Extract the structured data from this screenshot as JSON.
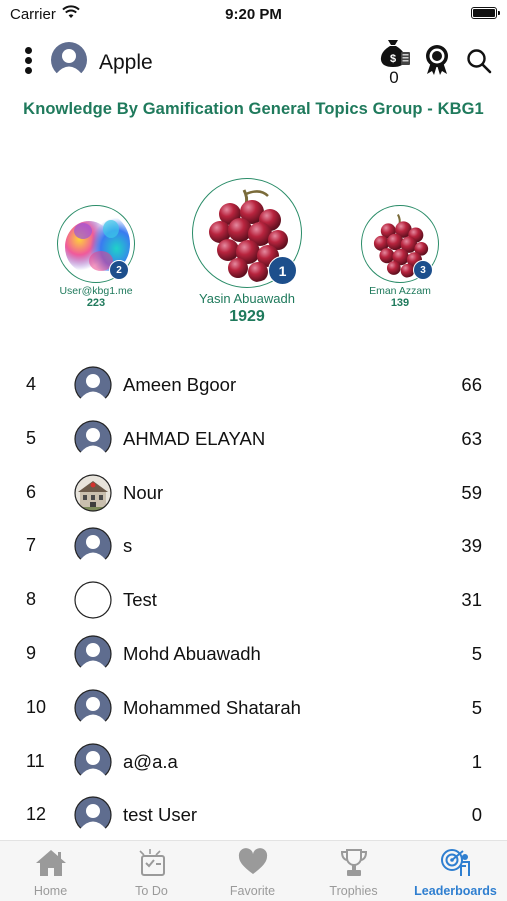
{
  "status_bar": {
    "carrier": "Carrier",
    "time": "9:20 PM"
  },
  "header": {
    "username": "Apple",
    "coins": "0"
  },
  "group_title": "Knowledge By Gamification General Topics Group - KBG1",
  "podium": [
    {
      "rank": "2",
      "name": "User@kbg1.me",
      "score": "223"
    },
    {
      "rank": "1",
      "name": "Yasin Abuawadh",
      "score": "1929"
    },
    {
      "rank": "3",
      "name": "Eman Azzam",
      "score": "139"
    }
  ],
  "leaderboard": [
    {
      "rank": "4",
      "name": "Ameen Bgoor",
      "score": "66",
      "avatar": "person-icon"
    },
    {
      "rank": "5",
      "name": "AHMAD ELAYAN",
      "score": "63",
      "avatar": "person-icon"
    },
    {
      "rank": "6",
      "name": "Nour",
      "score": "59",
      "avatar": "building-photo"
    },
    {
      "rank": "7",
      "name": "s",
      "score": "39",
      "avatar": "person-icon"
    },
    {
      "rank": "8",
      "name": "Test",
      "score": "31",
      "avatar": "empty"
    },
    {
      "rank": "9",
      "name": "Mohd Abuawadh",
      "score": "5",
      "avatar": "person-icon"
    },
    {
      "rank": "10",
      "name": "Mohammed Shatarah",
      "score": "5",
      "avatar": "person-icon"
    },
    {
      "rank": "11",
      "name": "a@a.a",
      "score": "1",
      "avatar": "person-icon"
    },
    {
      "rank": "12",
      "name": "test User",
      "score": "0",
      "avatar": "person-icon"
    }
  ],
  "tabs": [
    {
      "label": "Home",
      "icon": "home-icon",
      "active": false
    },
    {
      "label": "To Do",
      "icon": "todo-icon",
      "active": false
    },
    {
      "label": "Favorite",
      "icon": "heart-icon",
      "active": false
    },
    {
      "label": "Trophies",
      "icon": "trophy-icon",
      "active": false
    },
    {
      "label": "Leaderboards",
      "icon": "target-icon",
      "active": true
    }
  ],
  "colors": {
    "accent": "#1f7a5c",
    "active_tab": "#2f7fd0",
    "badge": "#1d4f8c",
    "avatar_bg": "#5f6d8f"
  }
}
